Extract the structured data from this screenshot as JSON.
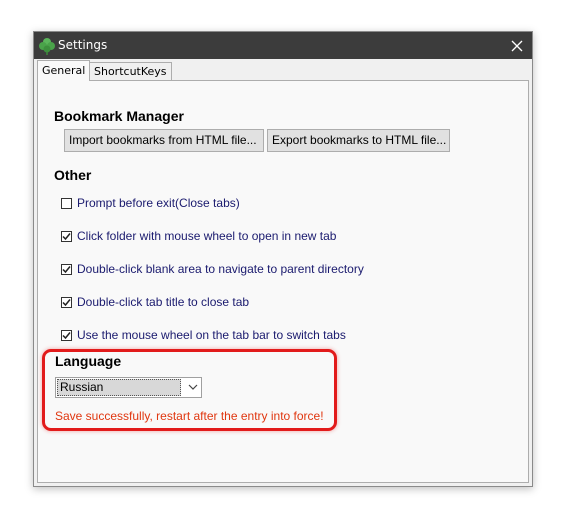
{
  "window": {
    "title": "Settings",
    "icon": "clover-icon",
    "close_icon": "close-icon"
  },
  "tabs": [
    {
      "label": "General",
      "active": true
    },
    {
      "label": "ShortcutKeys",
      "active": false
    }
  ],
  "bookmark_manager": {
    "heading": "Bookmark Manager",
    "import_label": "Import bookmarks from HTML file...",
    "export_label": "Export bookmarks to HTML file..."
  },
  "other": {
    "heading": "Other",
    "options": [
      {
        "label": "Prompt before exit(Close tabs)",
        "checked": false
      },
      {
        "label": "Click folder with mouse wheel to open in new tab",
        "checked": true
      },
      {
        "label": "Double-click blank area to navigate to parent directory",
        "checked": true
      },
      {
        "label": "Double-click tab title to close tab",
        "checked": true
      },
      {
        "label": "Use the mouse wheel on the tab bar to switch tabs",
        "checked": true
      }
    ]
  },
  "language": {
    "heading": "Language",
    "selected": "Russian",
    "status_message": "Save successfully, restart after the entry into force!"
  },
  "colors": {
    "titlebar": "#3c3c3c",
    "highlight": "#e21b1b",
    "status": "#e0360f",
    "option_text": "#1a1a6e"
  }
}
